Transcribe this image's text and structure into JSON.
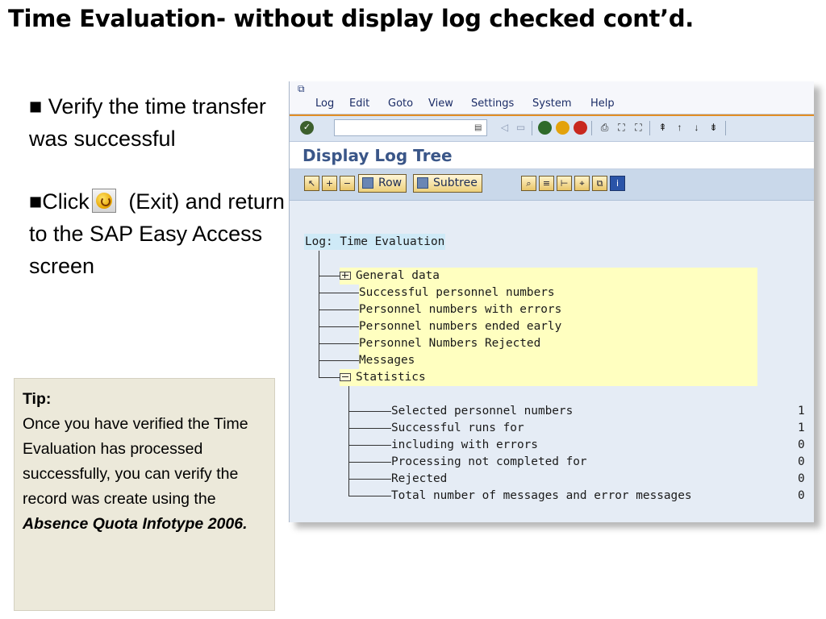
{
  "slide": {
    "title": "Time Evaluation- without display log checked cont’d.",
    "bullet1": "■  Verify the time transfer   was successful",
    "bullet2_prefix": "■Click",
    "bullet2_suffix": " (Exit) and return to the SAP Easy Access screen",
    "tip": {
      "heading": "Tip:",
      "body": "Once you have verified the Time Evaluation has processed successfully, you can verify the record was create using the",
      "emphasis": "Absence Quota Infotype 2006."
    }
  },
  "sap": {
    "menu": [
      "Log",
      "Edit",
      "Goto",
      "View",
      "Settings",
      "System",
      "Help"
    ],
    "screen_title": "Display Log Tree",
    "app_buttons": {
      "row": "Row",
      "subtree": "Subtree"
    },
    "tree": {
      "root": "Log: Time Evaluation",
      "nodes": [
        "General data",
        "Successful personnel numbers",
        "Personnel numbers with errors",
        "Personnel numbers ended early",
        "Personnel Numbers Rejected",
        "Messages",
        "Statistics"
      ],
      "statistics": [
        {
          "label": "Selected personnel numbers",
          "value": "1"
        },
        {
          "label": "Successful runs for",
          "value": "1"
        },
        {
          "label": "including with errors",
          "value": "0"
        },
        {
          "label": "Processing not completed for",
          "value": "0"
        },
        {
          "label": "Rejected",
          "value": "0"
        },
        {
          "label": "Total number of messages and error messages",
          "value": "0"
        }
      ]
    }
  },
  "colors": {
    "accent_orange": "#e18d24",
    "title_blue": "#3a5688",
    "highlight_yellow": "#ffffc0",
    "tip_bg": "#ece9da"
  }
}
